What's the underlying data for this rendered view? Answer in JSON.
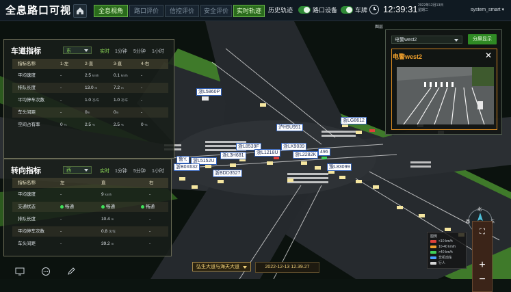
{
  "header": {
    "title": "全息路口可视",
    "tabs": [
      {
        "label": "全息视角",
        "active": true
      },
      {
        "label": "路口评价",
        "active": false
      },
      {
        "label": "信控评价",
        "active": false
      },
      {
        "label": "安全评价",
        "active": false
      }
    ],
    "track_tabs": [
      {
        "label": "实时轨迹",
        "active": true
      },
      {
        "label": "历史轨迹",
        "active": false
      }
    ],
    "toggles": [
      {
        "label": "路口设备",
        "on": true
      },
      {
        "label": "车牌",
        "on": true
      }
    ],
    "time": "12:39:31",
    "date_line1": "2022年12月13日",
    "date_line2": "星期二",
    "user": "system_smart"
  },
  "lane_panel": {
    "title": "车道指标",
    "direction": "东",
    "ranges": [
      {
        "label": "实时",
        "active": true
      },
      {
        "label": "1分钟",
        "active": false
      },
      {
        "label": "5分钟",
        "active": false
      },
      {
        "label": "1小时",
        "active": false
      }
    ],
    "columns": [
      "指标名称",
      "1-左",
      "2-直",
      "3-直",
      "4-右"
    ],
    "rows": [
      {
        "name": "平均速度",
        "cells": [
          "-",
          "2.5",
          "0.1",
          "-"
        ],
        "units": [
          "",
          "km/h",
          "km/h",
          ""
        ]
      },
      {
        "name": "排队长度",
        "cells": [
          "-",
          "13.0",
          "7.2",
          "-"
        ],
        "units": [
          "",
          "m",
          "m",
          ""
        ]
      },
      {
        "name": "平均停车次数",
        "cells": [
          "-",
          "1.0",
          "1.0",
          "-"
        ],
        "units": [
          "",
          "次/车",
          "次/车",
          ""
        ]
      },
      {
        "name": "车头间距",
        "cells": [
          "-",
          "0",
          "0",
          "-"
        ],
        "units": [
          "",
          "m",
          "m",
          ""
        ]
      },
      {
        "name": "空间占有率",
        "cells": [
          "0",
          "2.5",
          "2.5",
          "0"
        ],
        "units": [
          "%",
          "%",
          "%",
          "%"
        ]
      }
    ]
  },
  "turn_panel": {
    "title": "转向指标",
    "direction": "西",
    "ranges": [
      {
        "label": "实时",
        "active": true
      },
      {
        "label": "1分钟",
        "active": false
      },
      {
        "label": "5分钟",
        "active": false
      },
      {
        "label": "1小时",
        "active": false
      }
    ],
    "columns": [
      "指标名称",
      "左",
      "直",
      "右"
    ],
    "rows": [
      {
        "name": "平均速度",
        "cells": [
          "-",
          "9",
          "-"
        ],
        "units": [
          "",
          "km/h",
          ""
        ]
      },
      {
        "name": "交通状态",
        "cells": [
          "畅通",
          "畅通",
          "畅通"
        ],
        "units": [
          "",
          "",
          ""
        ],
        "status": true
      },
      {
        "name": "排队长度",
        "cells": [
          "-",
          "10.4",
          "-"
        ],
        "units": [
          "",
          "m",
          ""
        ]
      },
      {
        "name": "平均停车次数",
        "cells": [
          "-",
          "0.8",
          "-"
        ],
        "units": [
          "",
          "次/车",
          ""
        ]
      },
      {
        "name": "车头间距",
        "cells": [
          "-",
          "39.2",
          "-"
        ],
        "units": [
          "",
          "m",
          ""
        ]
      }
    ]
  },
  "plates": [
    "浙L5860P",
    "沪H9U951",
    "浙LG8612",
    "浙L8539F",
    "浙LK9039",
    "浙L1218U",
    "浙L3H681",
    "浙L2282K",
    "浙L5152U",
    "豫L83099",
    "浙BDD3527",
    "浙B0X632",
    "496",
    "鲁Y."
  ],
  "camera": {
    "selected": "电警west2",
    "split_label": "分屏显示",
    "title": "电警west2",
    "header_label": "图层"
  },
  "legend": {
    "title": "图例",
    "items": [
      {
        "label": "<10 km/h",
        "color": "#e0413a"
      },
      {
        "label": "10-40 km/h",
        "color": "#f0a02c"
      },
      {
        "label": ">40 km/h",
        "color": "#3fd05a"
      },
      {
        "label": "非机动车",
        "color": "#4aa0ff"
      },
      {
        "label": "行人",
        "color": "#d6d6d6"
      }
    ]
  },
  "compass": {
    "north": "北",
    "west": "西",
    "east": "东",
    "south": "南"
  },
  "bottom": {
    "road": "弘生大道与海天大道",
    "timestamp": "2022-12-13 12.39.27"
  }
}
